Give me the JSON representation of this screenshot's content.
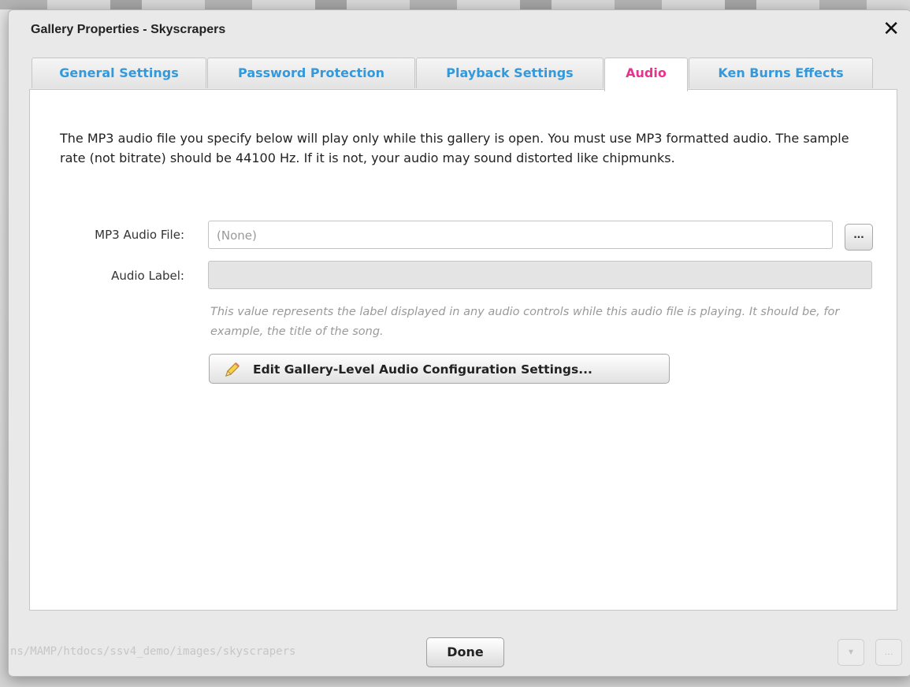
{
  "dialog": {
    "title": "Gallery Properties - Skyscrapers",
    "close_glyph": "✕"
  },
  "tabs": [
    {
      "label": "General Settings",
      "active": false
    },
    {
      "label": "Password Protection",
      "active": false
    },
    {
      "label": "Playback Settings",
      "active": false
    },
    {
      "label": "Audio",
      "active": true
    },
    {
      "label": "Ken Burns Effects",
      "active": false
    }
  ],
  "audio": {
    "description": "The MP3 audio file you specify below will play only while this gallery is open.  You must use MP3 formatted audio.  The sample rate (not bitrate) should be 44100 Hz.  If it is not, your audio may sound distorted like chipmunks.",
    "file_label": "MP3 Audio File:",
    "file_value": "(None)",
    "browse_label": "...",
    "audio_label_label": "Audio Label:",
    "audio_label_value": "",
    "hint": "This value represents the label displayed in any audio controls while this audio file is playing.  It should be, for example, the title of the song.",
    "edit_button_label": "Edit Gallery-Level Audio Configuration Settings..."
  },
  "footer": {
    "path_text": "ns/MAMP/htdocs/ssv4_demo/images/skyscrapers",
    "done_label": "Done"
  },
  "colors": {
    "tab_text": "#3399dd",
    "active_tab_text": "#e8338c"
  },
  "icons": {
    "close": "close-icon",
    "edit": "pencil-icon"
  }
}
